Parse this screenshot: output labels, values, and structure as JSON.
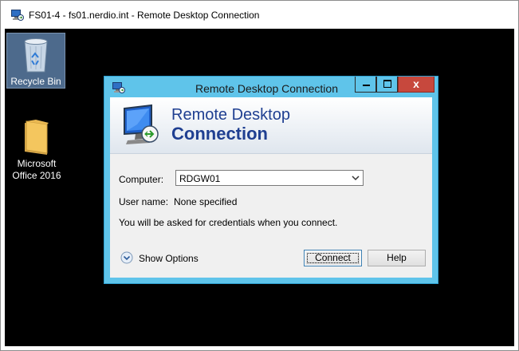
{
  "outer_window": {
    "title": "FS01-4 - fs01.nerdio.int - Remote Desktop Connection"
  },
  "desktop": {
    "icons": [
      {
        "label": "Recycle Bin",
        "icon": "recycle-bin-icon"
      },
      {
        "label_line1": "Microsoft",
        "label_line2": "Office 2016",
        "icon": "folder-icon"
      }
    ]
  },
  "dialog": {
    "title": "Remote Desktop Connection",
    "banner_line1": "Remote Desktop",
    "banner_line2": "Connection",
    "computer_label": "Computer:",
    "computer_value": "RDGW01",
    "username_label": "User name:",
    "username_value": "None specified",
    "info_text": "You will be asked for credentials when you connect.",
    "show_options_label": "Show Options",
    "connect_label": "Connect",
    "help_label": "Help",
    "close_glyph": "x"
  },
  "colors": {
    "dialog_frame": "#5fc4ea",
    "close_button": "#c7483d",
    "banner_text": "#1f3f91",
    "desktop_bg": "#000000"
  }
}
